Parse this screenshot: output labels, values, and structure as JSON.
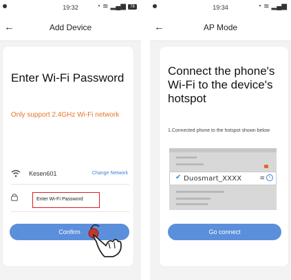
{
  "screens": [
    {
      "status_time": "19:32",
      "battery": "78",
      "nav_title": "Add Device",
      "heading": "Enter Wi-Fi Password",
      "note": "Only support 2.4GHz Wi-Fi network",
      "wifi_ssid": "Kesen601",
      "change_network": "Change Network",
      "password_placeholder": "Enter Wi-Fi Password",
      "button": "Confirm"
    },
    {
      "status_time": "19:34",
      "nav_title": "AP Mode",
      "heading": "Connect the phone's Wi-Fi to the device's hotspot",
      "step": "1.Connected phone to the hotspot shown below",
      "hotspot_name": "Duosmart_XXXX",
      "button": "Go connect"
    }
  ],
  "icons": {
    "back": "arrow-left-icon",
    "wifi": "wifi-icon",
    "lock": "lock-icon",
    "hand": "hand-pointer-icon",
    "check": "check-icon",
    "info": "info-icon"
  },
  "colors": {
    "accent_button": "#5b8fdc",
    "warning_text": "#e9722b",
    "link": "#3d7fd6",
    "highlight_border": "#e11a1a"
  }
}
